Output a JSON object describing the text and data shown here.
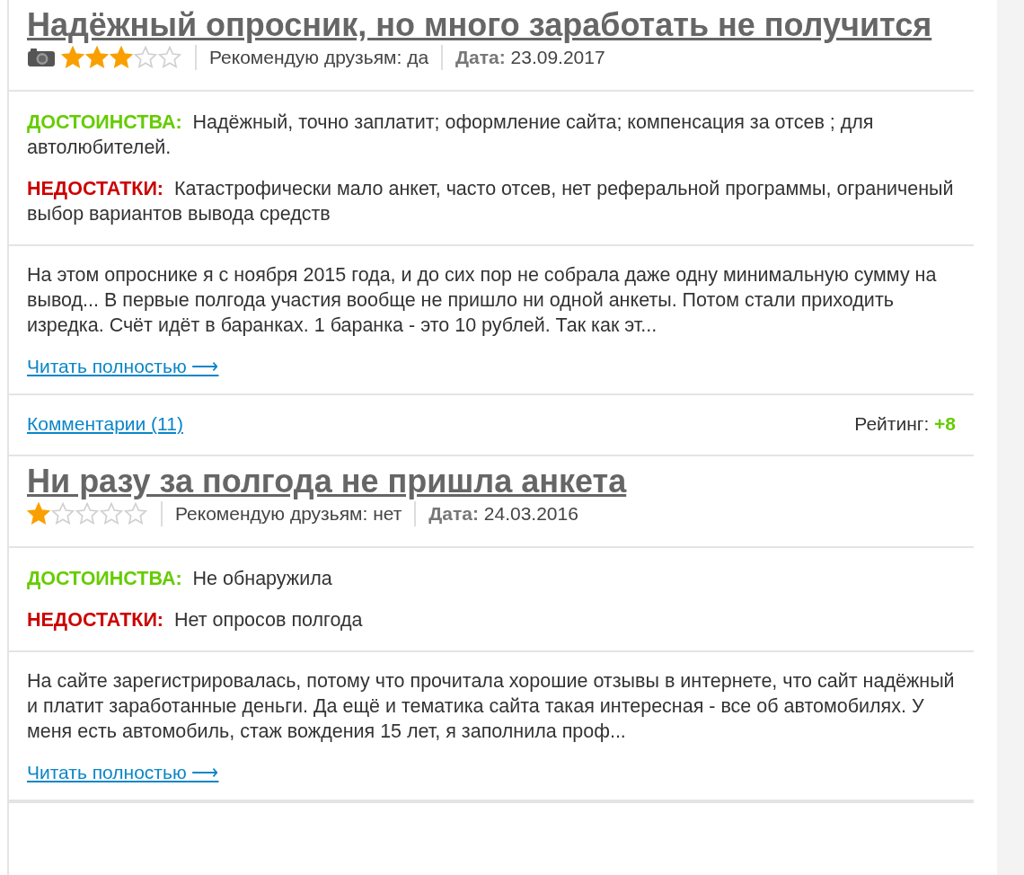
{
  "reviews": [
    {
      "title": "Надёжный опросник, но много заработать не получится",
      "has_photo": true,
      "stars": 3,
      "recommend_label": "Рекомендую друзьям:",
      "recommend_value": "да",
      "date_label": "Дата:",
      "date_value": "23.09.2017",
      "pros_label": "ДОСТОИНСТВА:",
      "pros": "Надёжный, точно заплатит; оформление сайта; компенсация за отсев ; для автолюбителей.",
      "cons_label": "НЕДОСТАТКИ:",
      "cons": "Катастрофически мало анкет, часто отсев, нет реферальной программы, ограниченый выбор вариантов вывода средств",
      "text": "На этом опроснике я с ноября 2015 года, и до сих пор не собрала даже одну минимальную сумму на вывод... В первые полгода участия вообще не пришло ни одной анкеты. Потом стали приходить изредка. Счёт идёт в баранках. 1 баранка - это 10 рублей. Так как эт...",
      "read_more": "Читать полностью ⟶",
      "footer": {
        "comments": "Комментарии (11)",
        "rating_label": "Рейтинг:",
        "rating_value": "+8"
      }
    },
    {
      "title": "Ни разу за полгода не пришла анкета",
      "has_photo": false,
      "stars": 1,
      "recommend_label": "Рекомендую друзьям:",
      "recommend_value": "нет",
      "date_label": "Дата:",
      "date_value": "24.03.2016",
      "pros_label": "ДОСТОИНСТВА:",
      "pros": "Не обнаружила",
      "cons_label": "НЕДОСТАТКИ:",
      "cons": "Нет опросов полгода",
      "text": "На сайте зарегистрировалась, потому что прочитала хорошие отзывы в интернете, что сайт надёжный и платит заработанные деньги. Да ещё и тематика сайта такая интересная - все об автомобилях. У меня есть автомобиль, стаж вождения 15 лет, я заполнила проф...",
      "read_more": "Читать полностью ⟶"
    }
  ]
}
